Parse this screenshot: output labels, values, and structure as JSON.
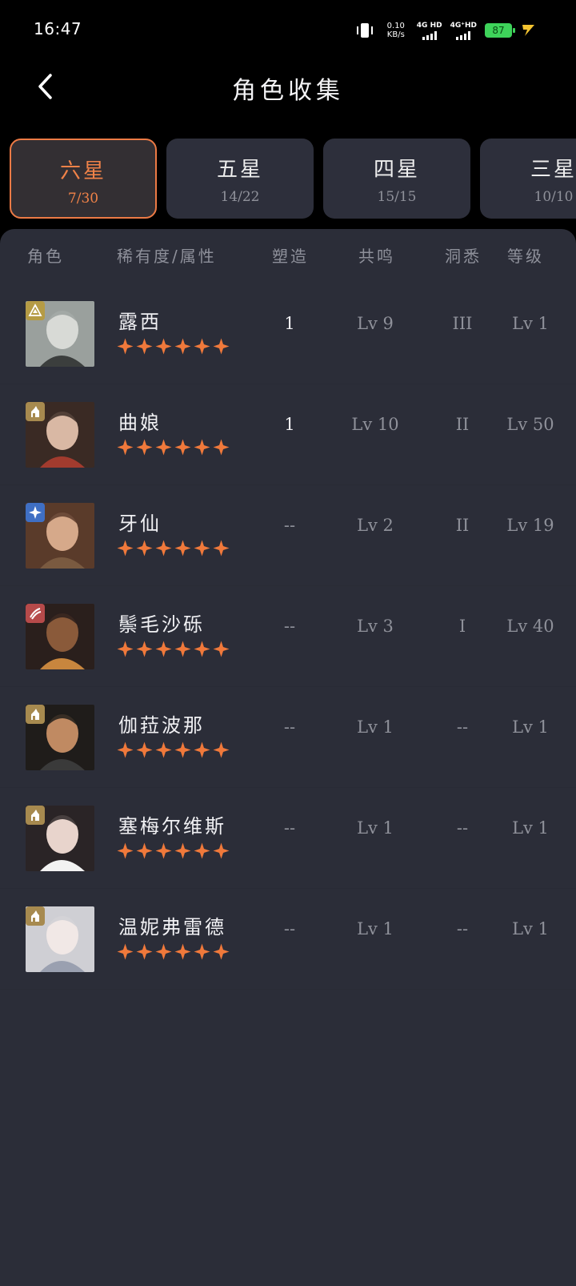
{
  "status": {
    "time": "16:47",
    "net_speed_value": "0.10",
    "net_speed_unit": "KB/s",
    "sim1": "4G HD",
    "sim2": "4G⁺HD",
    "battery": "87"
  },
  "header": {
    "title": "角色收集"
  },
  "tabs": [
    {
      "label": "六星",
      "count": "7/30",
      "active": true
    },
    {
      "label": "五星",
      "count": "14/22",
      "active": false
    },
    {
      "label": "四星",
      "count": "15/15",
      "active": false
    },
    {
      "label": "三星",
      "count": "10/10",
      "active": false
    }
  ],
  "columns": {
    "character": "角色",
    "rarity": "稀有度/属性",
    "shaping": "塑造",
    "resonance": "共鸣",
    "insight": "洞悉",
    "level": "等级"
  },
  "characters": [
    {
      "name": "露西",
      "stars": 6,
      "element": "yellow-triangle",
      "shaping": "1",
      "resonance": "Lv 9",
      "insight": "III",
      "level": "Lv 1"
    },
    {
      "name": "曲娘",
      "stars": 6,
      "element": "beast",
      "shaping": "1",
      "resonance": "Lv 10",
      "insight": "II",
      "level": "Lv 50"
    },
    {
      "name": "牙仙",
      "stars": 6,
      "element": "blue-star",
      "shaping": "--",
      "resonance": "Lv 2",
      "insight": "II",
      "level": "Lv 19"
    },
    {
      "name": "鬃毛沙砾",
      "stars": 6,
      "element": "red-claw",
      "shaping": "--",
      "resonance": "Lv 3",
      "insight": "I",
      "level": "Lv 40"
    },
    {
      "name": "伽菈波那",
      "stars": 6,
      "element": "beast",
      "shaping": "--",
      "resonance": "Lv 1",
      "insight": "--",
      "level": "Lv 1"
    },
    {
      "name": "塞梅尔维斯",
      "stars": 6,
      "element": "beast",
      "shaping": "--",
      "resonance": "Lv 1",
      "insight": "--",
      "level": "Lv 1"
    },
    {
      "name": "温妮弗雷德",
      "stars": 6,
      "element": "beast",
      "shaping": "--",
      "resonance": "Lv 1",
      "insight": "--",
      "level": "Lv 1"
    }
  ],
  "colors": {
    "accent": "#ec7a45",
    "star": "#f0793b",
    "panel": "#2b2d38"
  }
}
